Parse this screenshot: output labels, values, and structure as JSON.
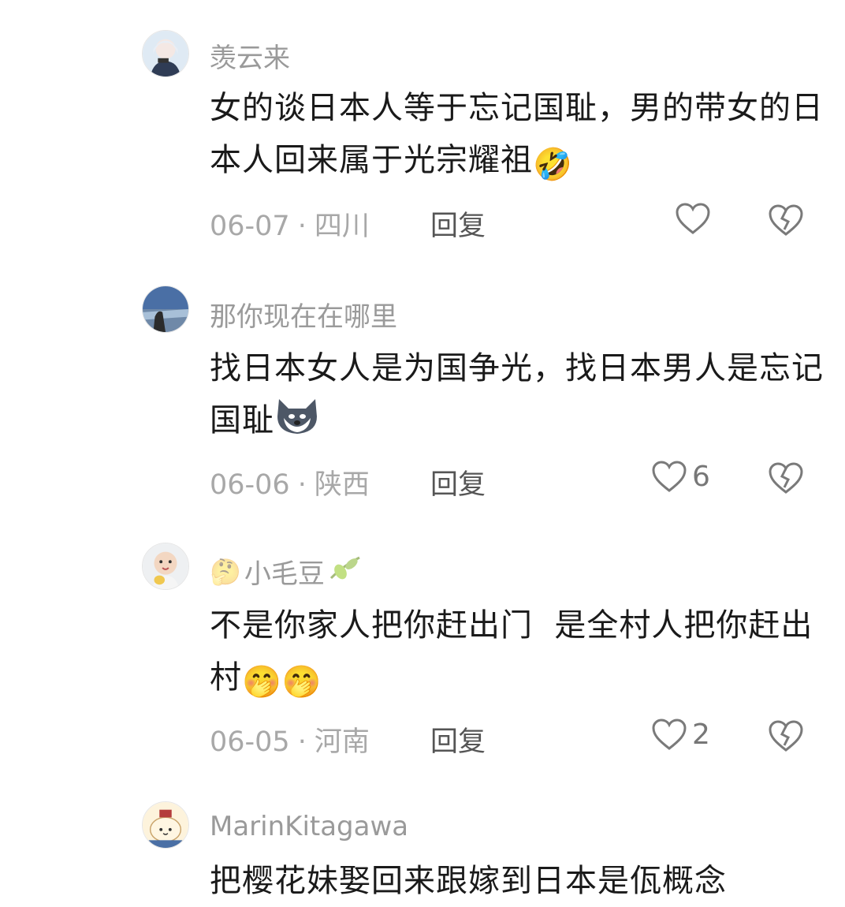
{
  "comments": [
    {
      "username": "羡云来",
      "text": "女的谈日本人等于忘记国耻，男的带女的日本人回来属于光宗耀祖",
      "emoji": "🤣",
      "date": "06-07",
      "location": "四川",
      "reply_label": "回复",
      "likes": ""
    },
    {
      "username": "那你现在在哪里",
      "text": "找日本女人是为国争光，找日本男人是忘记国耻",
      "emoji": "dog-emoji",
      "date": "06-06",
      "location": "陕西",
      "reply_label": "回复",
      "likes": "6"
    },
    {
      "username": "小毛豆",
      "username_prefix_emoji": "🤔",
      "username_suffix_emoji": "olive-emoji",
      "text": "不是你家人把你赶出门  是全村人把你赶出村",
      "emoji": "🤭🤭",
      "date": "06-05",
      "location": "河南",
      "reply_label": "回复",
      "likes": "2"
    },
    {
      "username": "MarinKitagawa",
      "text": "把樱花妹娶回来跟嫁到日本是佤概念"
    }
  ],
  "colors": {
    "username": "#9a9a9a",
    "text": "#1a1a1a",
    "meta": "#a8a8a8",
    "icon": "#777777"
  }
}
